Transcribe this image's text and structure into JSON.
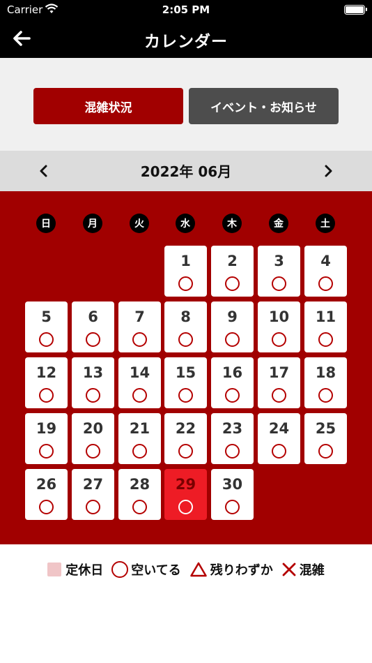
{
  "status_bar": {
    "carrier": "Carrier",
    "time": "2:05 PM"
  },
  "nav": {
    "title": "カレンダー"
  },
  "tabs": [
    {
      "label": "混雑状況",
      "active": true
    },
    {
      "label": "イベント・お知らせ",
      "active": false
    }
  ],
  "month": {
    "label": "2022年 06月"
  },
  "weekdays": [
    "日",
    "月",
    "火",
    "水",
    "木",
    "金",
    "土"
  ],
  "days": [
    {
      "day": "1",
      "status": "空いてる"
    },
    {
      "day": "2",
      "status": "空いてる"
    },
    {
      "day": "3",
      "status": "空いてる"
    },
    {
      "day": "4",
      "status": "空いてる"
    },
    {
      "day": "5",
      "status": "空いてる"
    },
    {
      "day": "6",
      "status": "空いてる"
    },
    {
      "day": "7",
      "status": "空いてる"
    },
    {
      "day": "8",
      "status": "空いてる"
    },
    {
      "day": "9",
      "status": "空いてる"
    },
    {
      "day": "10",
      "status": "空いてる"
    },
    {
      "day": "11",
      "status": "空いてる"
    },
    {
      "day": "12",
      "status": "空いてる"
    },
    {
      "day": "13",
      "status": "空いてる"
    },
    {
      "day": "14",
      "status": "空いてる"
    },
    {
      "day": "15",
      "status": "空いてる"
    },
    {
      "day": "16",
      "status": "空いてる"
    },
    {
      "day": "17",
      "status": "空いてる"
    },
    {
      "day": "18",
      "status": "空いてる"
    },
    {
      "day": "19",
      "status": "空いてる"
    },
    {
      "day": "20",
      "status": "空いてる"
    },
    {
      "day": "21",
      "status": "空いてる"
    },
    {
      "day": "22",
      "status": "空いてる"
    },
    {
      "day": "23",
      "status": "空いてる"
    },
    {
      "day": "24",
      "status": "空いてる"
    },
    {
      "day": "25",
      "status": "空いてる"
    },
    {
      "day": "26",
      "status": "空いてる"
    },
    {
      "day": "27",
      "status": "空いてる"
    },
    {
      "day": "28",
      "status": "空いてる"
    },
    {
      "day": "29",
      "status": "空いてる",
      "today": true
    },
    {
      "day": "30",
      "status": "空いてる"
    }
  ],
  "legend": {
    "closed": "定休日",
    "available": "空いてる",
    "few_left": "残りわずか",
    "crowded": "混雑"
  },
  "colors": {
    "brand_red": "#a10000",
    "today_red": "#ee1c25",
    "closed_pink": "#f0c5c7"
  }
}
